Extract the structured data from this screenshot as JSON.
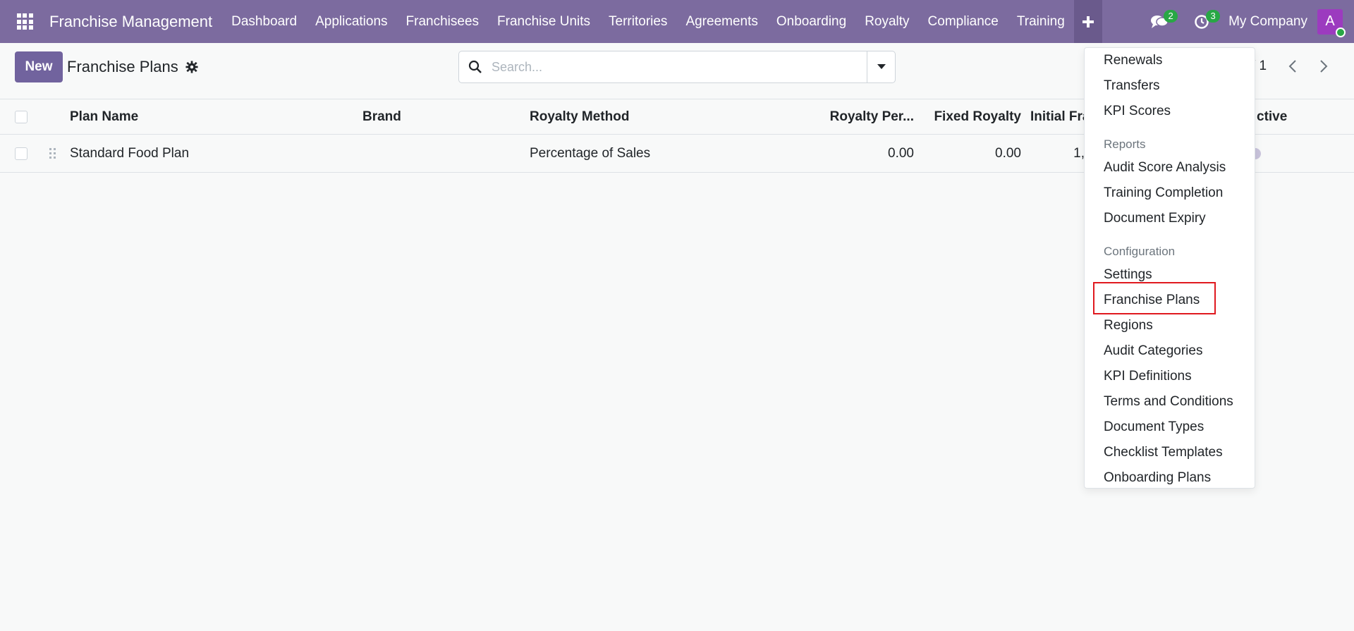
{
  "nav": {
    "brand": "Franchise Management",
    "items": [
      "Dashboard",
      "Applications",
      "Franchisees",
      "Franchise Units",
      "Territories",
      "Agreements",
      "Onboarding",
      "Royalty",
      "Compliance",
      "Training"
    ],
    "plus_icon": "plus-icon",
    "messages_badge": "2",
    "activities_badge": "3",
    "company": "My Company",
    "avatar_letter": "A"
  },
  "control": {
    "new_label": "New",
    "title": "Franchise Plans",
    "search_placeholder": "Search...",
    "pager": "/ 1"
  },
  "table": {
    "headers": [
      "Plan Name",
      "Brand",
      "Royalty Method",
      "Royalty Per...",
      "Fixed Royalty",
      "Initial Fra",
      "ctive"
    ],
    "rows": [
      {
        "plan_name": "Standard Food Plan",
        "brand": "",
        "royalty_method": "Percentage of Sales",
        "royalty_percent": "0.00",
        "fixed_royalty": "0.00",
        "initial_fee": "1,"
      }
    ]
  },
  "dropdown": {
    "items_top": [
      "Renewals",
      "Transfers",
      "KPI Scores"
    ],
    "reports_header": "Reports",
    "reports_items": [
      "Audit Score Analysis",
      "Training Completion",
      "Document Expiry"
    ],
    "config_header": "Configuration",
    "config_items": [
      "Settings",
      "Franchise Plans",
      "Regions",
      "Audit Categories",
      "KPI Definitions",
      "Terms and Conditions",
      "Document Types",
      "Checklist Templates",
      "Onboarding Plans"
    ]
  },
  "colors": {
    "navbar": "#7c6b9f",
    "primary_button": "#71639e",
    "badge": "#28a745",
    "highlight": "#e0191f"
  }
}
